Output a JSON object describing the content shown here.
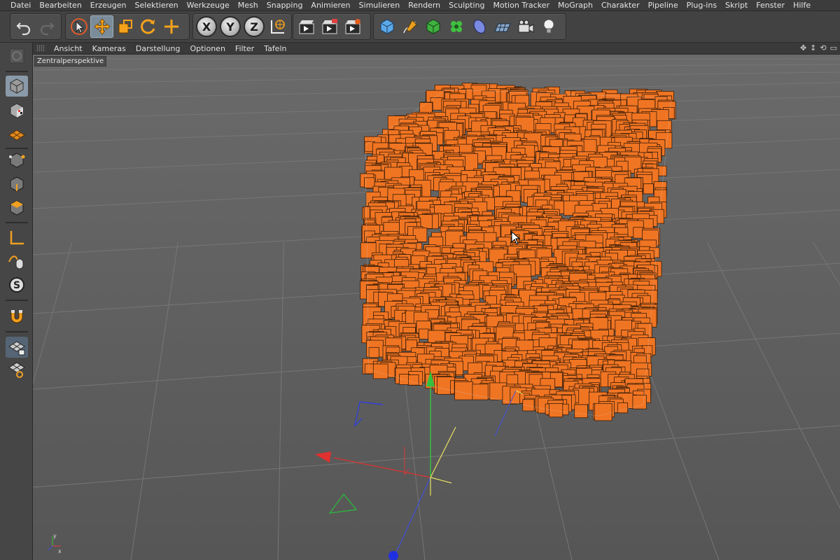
{
  "menu": {
    "items": [
      "Datei",
      "Bearbeiten",
      "Erzeugen",
      "Selektieren",
      "Werkzeuge",
      "Mesh",
      "Snapping",
      "Animieren",
      "Simulieren",
      "Rendern",
      "Sculpting",
      "Motion Tracker",
      "MoGraph",
      "Charakter",
      "Pipeline",
      "Plug-ins",
      "Skript",
      "Fenster",
      "Hilfe"
    ]
  },
  "toolbar": {
    "axes": {
      "x": "X",
      "y": "Y",
      "z": "Z"
    },
    "active_tool": "move",
    "icons": [
      "undo-icon",
      "redo-icon",
      "select-icon",
      "move-icon",
      "scale-icon",
      "rotate-icon",
      "add-icon",
      "x-axis-lock",
      "y-axis-lock",
      "z-axis-lock",
      "world-coordinates-icon",
      "render-view-icon",
      "render-picture-viewer-icon",
      "render-settings-icon",
      "cube-icon",
      "pen-icon",
      "subdivision-icon",
      "cloner-icon",
      "deformer-icon",
      "floor-icon",
      "camera-icon",
      "light-icon"
    ]
  },
  "viewport": {
    "menu": [
      "Ansicht",
      "Kameras",
      "Darstellung",
      "Optionen",
      "Filter",
      "Tafeln"
    ],
    "label": "Zentralperspektive",
    "object_color": "#f07523",
    "object_edge_color": "#3a1d08",
    "grid_background": "#5c5c5c",
    "grid_line": "#707070",
    "axis_colors": {
      "x": "#e03030",
      "y": "#34c040",
      "z": "#2a40e0"
    }
  },
  "colors": {
    "ui_dark": "#3c3c3c",
    "ui_mid": "#4d4d4d",
    "accent_active": "#7b8c9a",
    "icon_orange": "#f0a020"
  }
}
